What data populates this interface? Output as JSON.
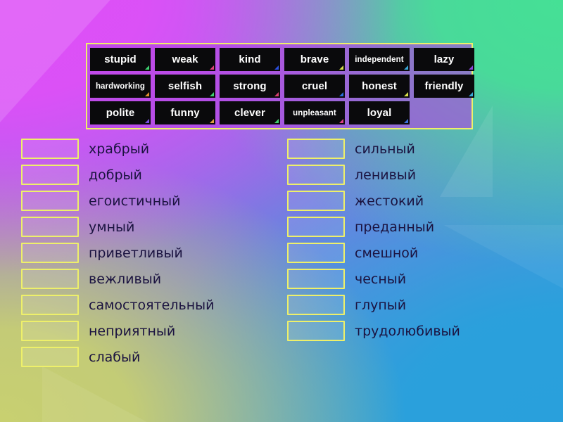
{
  "activity": {
    "type": "match-up",
    "language_pair": "English to Russian"
  },
  "colors": {
    "tray_border": "#eef06a",
    "tray_fill": "#b046e0",
    "tile_bg": "#0a0a0c",
    "tile_text": "#ffffff",
    "dropzone_border": "#eef06a",
    "label_text": "#1b1340",
    "bg_top_left": "#dd50f7",
    "bg_top_right": "#45e095",
    "bg_bottom_left": "#c8d070",
    "bg_bottom_right": "#29a0dc",
    "bg_center": "#8078e0"
  },
  "word_bank": {
    "rows": [
      [
        {
          "label": "stupid",
          "size": "normal",
          "corner": "#3fd070"
        },
        {
          "label": "weak",
          "size": "normal",
          "corner": "#e0407a"
        },
        {
          "label": "kind",
          "size": "normal",
          "corner": "#2a4fe0"
        },
        {
          "label": "brave",
          "size": "normal",
          "corner": "#d8e04a"
        },
        {
          "label": "independent",
          "size": "small",
          "corner": "#3aa8d8"
        },
        {
          "label": "lazy",
          "size": "normal",
          "corner": "#8a46d8"
        }
      ],
      [
        {
          "label": "hardworking",
          "size": "small",
          "corner": "#e09030"
        },
        {
          "label": "selfish",
          "size": "normal",
          "corner": "#3fd070"
        },
        {
          "label": "strong",
          "size": "normal",
          "corner": "#d84070"
        },
        {
          "label": "cruel",
          "size": "normal",
          "corner": "#2a6fe0"
        },
        {
          "label": "honest",
          "size": "normal",
          "corner": "#d8e04a"
        },
        {
          "label": "friendly",
          "size": "normal",
          "corner": "#3aa8d8"
        }
      ],
      [
        {
          "label": "polite",
          "size": "normal",
          "corner": "#7a50e0"
        },
        {
          "label": "funny",
          "size": "normal",
          "corner": "#e0a040"
        },
        {
          "label": "clever",
          "size": "normal",
          "corner": "#3fd070"
        },
        {
          "label": "unpleasant",
          "size": "small",
          "corner": "#e0408a"
        },
        {
          "label": "loyal",
          "size": "normal",
          "corner": "#3a6fd8"
        },
        {
          "label": "",
          "size": "empty",
          "corner": ""
        }
      ]
    ]
  },
  "answers": {
    "left_column": [
      {
        "dropzone_value": "",
        "label": "храбрый"
      },
      {
        "dropzone_value": "",
        "label": "добрый"
      },
      {
        "dropzone_value": "",
        "label": "егоистичный"
      },
      {
        "dropzone_value": "",
        "label": "умный"
      },
      {
        "dropzone_value": "",
        "label": "приветливый"
      },
      {
        "dropzone_value": "",
        "label": "вежливый"
      },
      {
        "dropzone_value": "",
        "label": "самостоятельный"
      },
      {
        "dropzone_value": "",
        "label": "неприятный"
      },
      {
        "dropzone_value": "",
        "label": "слабый"
      }
    ],
    "right_column": [
      {
        "dropzone_value": "",
        "label": "сильный"
      },
      {
        "dropzone_value": "",
        "label": "ленивый"
      },
      {
        "dropzone_value": "",
        "label": "жестокий"
      },
      {
        "dropzone_value": "",
        "label": "преданный"
      },
      {
        "dropzone_value": "",
        "label": "смешной"
      },
      {
        "dropzone_value": "",
        "label": "чесный"
      },
      {
        "dropzone_value": "",
        "label": "глупый"
      },
      {
        "dropzone_value": "",
        "label": "трудолюбивый"
      }
    ]
  }
}
